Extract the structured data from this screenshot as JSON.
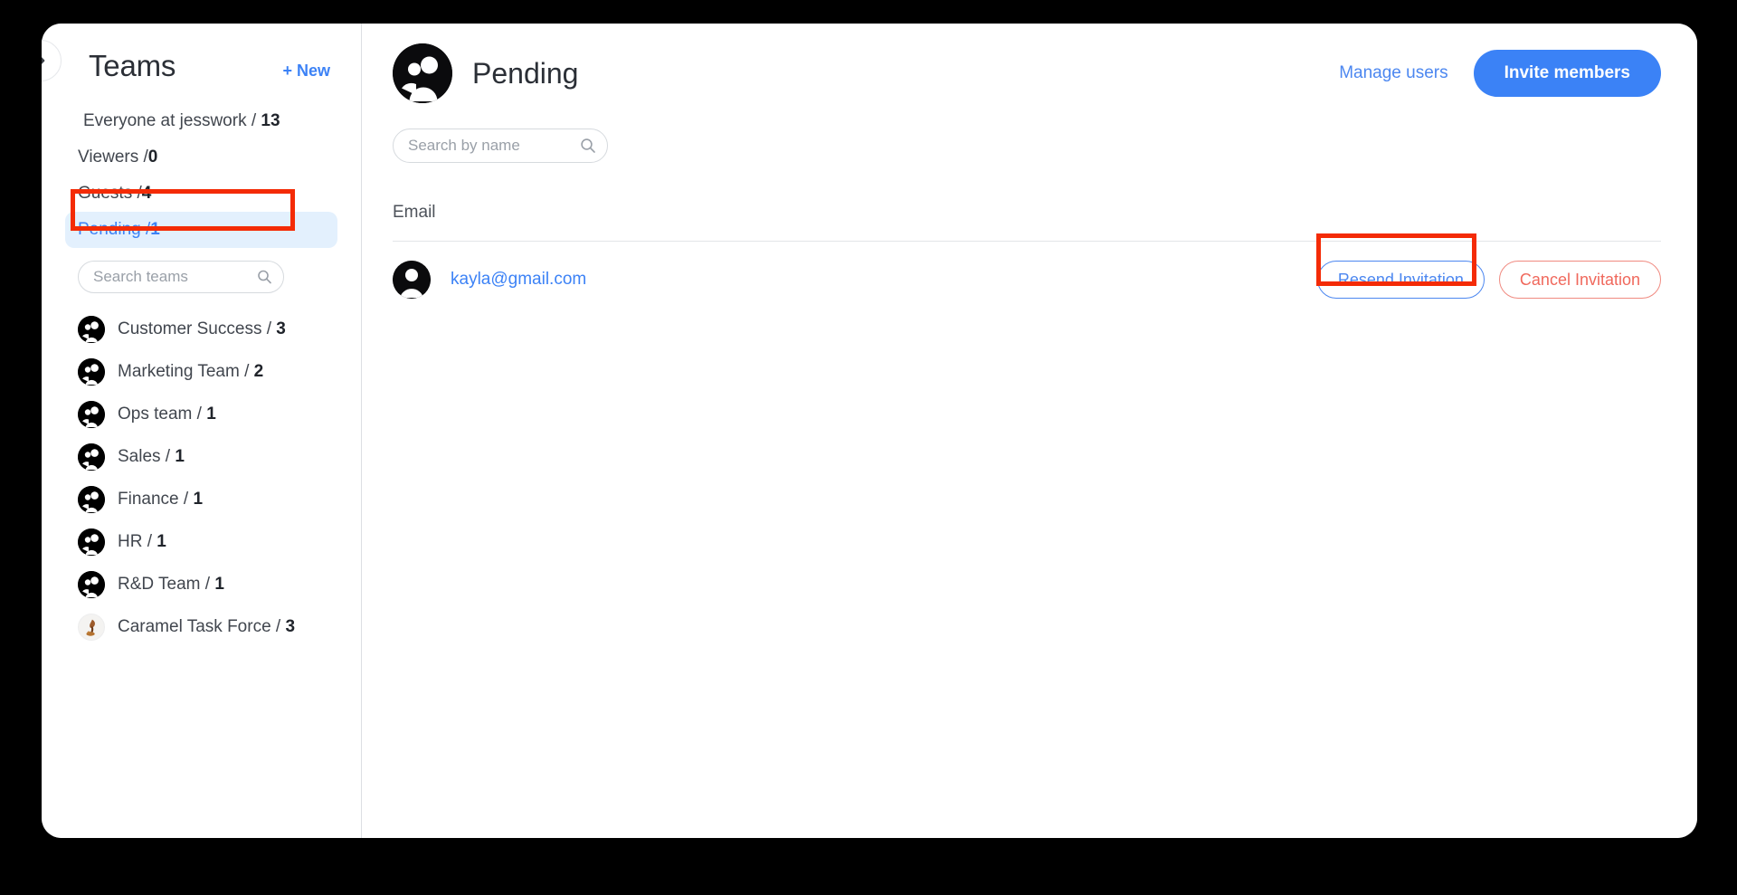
{
  "sidebar": {
    "collapse_icon": "chevron-right-icon",
    "title": "Teams",
    "new_label": "+ New",
    "scopes": [
      {
        "label": "Everyone at jesswork /",
        "count": "13",
        "active": false,
        "indent": true
      },
      {
        "label": "Viewers /",
        "count": "0",
        "active": false,
        "indent": false
      },
      {
        "label": "Guests /",
        "count": "4",
        "active": false,
        "indent": false
      },
      {
        "label": "Pending /",
        "count": "1",
        "active": true,
        "indent": false
      }
    ],
    "search": {
      "placeholder": "Search teams",
      "value": "",
      "icon": "search-icon"
    },
    "teams": [
      {
        "name": "Customer Success /",
        "count": "3",
        "avatar": "group-icon"
      },
      {
        "name": "Marketing Team /",
        "count": "2",
        "avatar": "group-icon"
      },
      {
        "name": "Ops team /",
        "count": "1",
        "avatar": "group-icon"
      },
      {
        "name": "Sales /",
        "count": "1",
        "avatar": "group-icon"
      },
      {
        "name": "Finance /",
        "count": "1",
        "avatar": "group-icon"
      },
      {
        "name": "HR /",
        "count": "1",
        "avatar": "group-icon"
      },
      {
        "name": "R&D Team /",
        "count": "1",
        "avatar": "group-icon"
      },
      {
        "name": "Caramel Task Force /",
        "count": "3",
        "avatar": "caramel-photo-icon"
      }
    ]
  },
  "main": {
    "avatar_icon": "group-avatar-icon",
    "title": "Pending",
    "manage_users_label": "Manage users",
    "invite_members_label": "Invite members",
    "search": {
      "placeholder": "Search by name",
      "value": "",
      "icon": "search-icon"
    },
    "column_header": "Email",
    "rows": [
      {
        "avatar_icon": "person-avatar-icon",
        "email": "kayla@gmail.com",
        "resend_label": "Resend Invitation",
        "cancel_label": "Cancel Invitation"
      }
    ]
  },
  "colors": {
    "accent_blue": "#3b82f6",
    "link_blue": "#4c87f0",
    "active_bg": "#e3f0fd",
    "danger_red": "#f0685c",
    "annotation_red": "#f42b06",
    "text_dark": "#2b2f36",
    "canvas_black": "#000000"
  }
}
